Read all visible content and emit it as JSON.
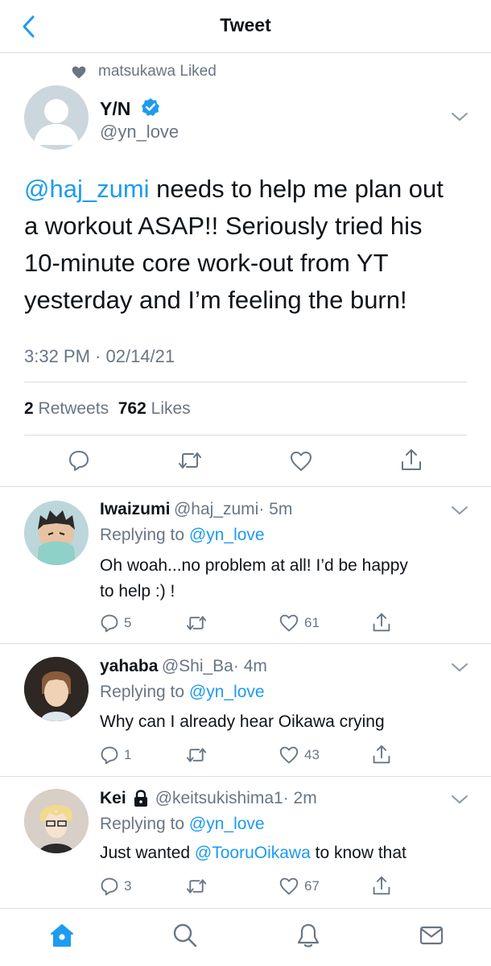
{
  "header": {
    "title": "Tweet"
  },
  "tweet": {
    "liked_by": "matsukawa Liked",
    "author_name": "Y/N",
    "author_handle": "@yn_love",
    "text_mention": "@haj_zumi",
    "text_line1_rest": " needs to help me plan out",
    "text_line2": "a workout ASAP!! Seriously tried his",
    "text_line3": "10-minute core work-out from YT",
    "text_line4": "yesterday and I’m feeling the burn!",
    "timestamp": "3:32 PM · 02/14/21",
    "retweets_count": "2",
    "retweets_label": "Retweets",
    "likes_count": "762",
    "likes_label": "Likes"
  },
  "replies": [
    {
      "name": "Iwaizumi",
      "handle": "@haj_zumi",
      "time": "· 5m",
      "replying_prefix": "Replying to",
      "replying_to": "@yn_love",
      "text_line1": "Oh woah...no problem at all! I’d be happy",
      "text_line2": "to help :) !",
      "reply_count": "5",
      "like_count": "61"
    },
    {
      "name": "yahaba",
      "handle": "@Shi_Ba",
      "time": "· 4m",
      "replying_prefix": "Replying to",
      "replying_to": "@yn_love",
      "text_line1": "Why can I already hear Oikawa crying",
      "reply_count": "1",
      "like_count": "43"
    },
    {
      "name": "Kei",
      "handle": "@keitsukishima1",
      "time": "· 2m",
      "replying_prefix": "Replying to",
      "replying_to": "@yn_love",
      "text_prefix": "Just wanted ",
      "text_mention": "@TooruOikawa",
      "text_suffix": " to know that",
      "reply_count": "3",
      "like_count": "67"
    }
  ],
  "colors": {
    "accent": "#1d9bf0",
    "secondary_text": "#687684",
    "verified": "#1d9bf0"
  },
  "icons": {
    "back": "chevron-left-icon",
    "liked": "heart-filled-icon",
    "verified": "verified-badge-icon",
    "locked": "lock-icon",
    "reply": "comment-icon",
    "retweet": "retweet-icon",
    "like": "heart-icon",
    "share": "share-icon",
    "tab_home": "home-icon",
    "tab_search": "search-icon",
    "tab_notifications": "bell-icon",
    "tab_messages": "mail-icon"
  }
}
